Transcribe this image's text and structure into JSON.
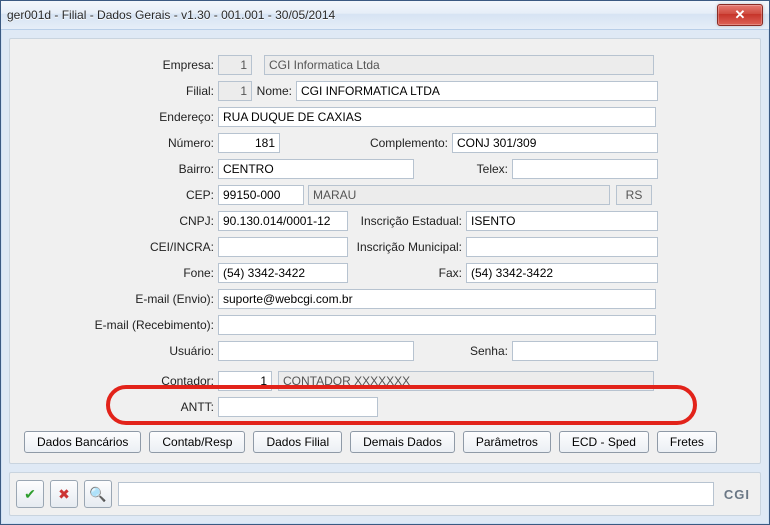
{
  "window": {
    "title": "ger001d - Filial - Dados Gerais - v1.30 - 001.001 - 30/05/2014"
  },
  "labels": {
    "empresa": "Empresa:",
    "filial": "Filial:",
    "nome": "Nome:",
    "endereco": "Endereço:",
    "numero": "Número:",
    "complemento": "Complemento:",
    "bairro": "Bairro:",
    "telex": "Telex:",
    "cep": "CEP:",
    "cnpj": "CNPJ:",
    "insc_est": "Inscrição Estadual:",
    "cei": "CEI/INCRA:",
    "insc_mun": "Inscrição Municipal:",
    "fone": "Fone:",
    "fax": "Fax:",
    "email_env": "E-mail (Envio):",
    "email_rec": "E-mail (Recebimento):",
    "usuario": "Usuário:",
    "senha": "Senha:",
    "contador": "Contador:",
    "antt": "ANTT:"
  },
  "fields": {
    "empresa_id": "1",
    "empresa_nome": "CGI Informatica Ltda",
    "filial_id": "1",
    "filial_nome": "CGI INFORMATICA LTDA",
    "endereco": "RUA DUQUE DE CAXIAS",
    "numero": "181",
    "complemento": "CONJ 301/309",
    "bairro": "CENTRO",
    "telex": "",
    "cep": "99150-000",
    "cidade": "MARAU",
    "uf": "RS",
    "cnpj": "90.130.014/0001-12",
    "insc_est": "ISENTO",
    "cei": "",
    "insc_mun": "",
    "fone": "(54) 3342-3422",
    "fax": "(54) 3342-3422",
    "email_env": "suporte@webcgi.com.br",
    "email_rec": "",
    "usuario": "",
    "senha": "",
    "contador_id": "1",
    "contador_nome": "CONTADOR XXXXXXX",
    "antt": ""
  },
  "buttons": {
    "dados_banc": "Dados Bancários",
    "contab": "Contab/Resp",
    "dados_filial": "Dados Filial",
    "demais": "Demais Dados",
    "param": "Parâmetros",
    "ecd": "ECD - Sped",
    "fretes": "Fretes"
  },
  "bottom": {
    "brand": "CGI"
  },
  "icons": {
    "ok": "✔",
    "cancel": "✖",
    "search": "🔍"
  },
  "colors": {
    "highlight": "#e2231a"
  }
}
